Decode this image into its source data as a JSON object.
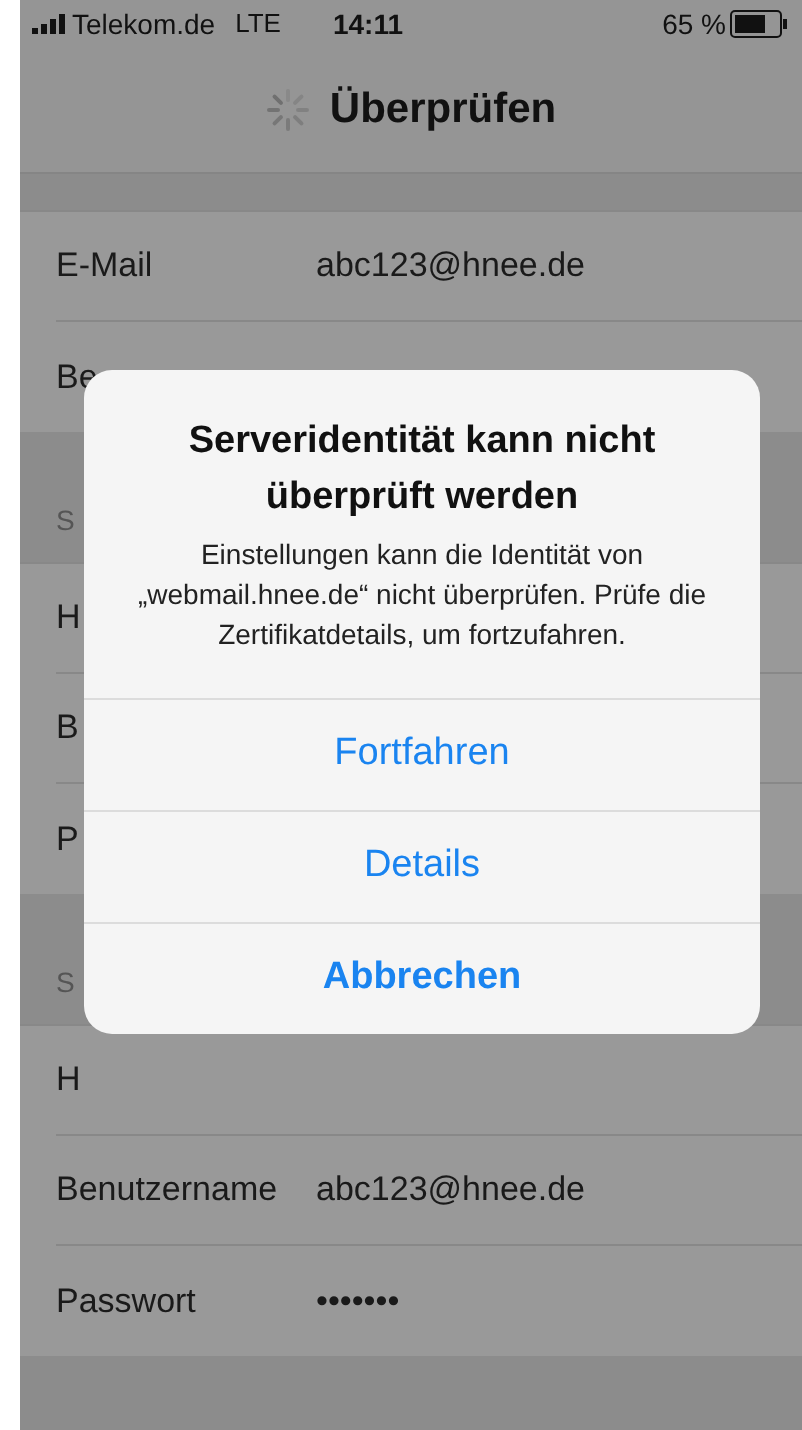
{
  "status_bar": {
    "carrier": "Telekom.de",
    "network": "LTE",
    "time": "14:11",
    "battery": "65 %"
  },
  "nav": {
    "title": "Überprüfen"
  },
  "sections": [
    {
      "rows": [
        {
          "label": "E-Mail",
          "value": "abc123@hnee.de"
        },
        {
          "label": "Be"
        }
      ]
    },
    {
      "header": "S",
      "rows": [
        {
          "label": "H"
        },
        {
          "label": "B"
        },
        {
          "label": "P"
        }
      ]
    },
    {
      "header": "S",
      "rows": [
        {
          "label": "H"
        },
        {
          "label": "Benutzername",
          "value": "abc123@hnee.de"
        },
        {
          "label": "Passwort",
          "value": "•••••••"
        }
      ]
    }
  ],
  "alert": {
    "title": "Serveridentität kann nicht überprüft werden",
    "message": "Einstellungen kann die Identität von „webmail.hnee.de“ nicht überprüfen. Prüfe die Zertifikatdetails, um fortzufahren.",
    "actions": [
      {
        "label": "Fortfahren",
        "kind": "default"
      },
      {
        "label": "Details",
        "kind": "default"
      },
      {
        "label": "Abbrechen",
        "kind": "cancel"
      }
    ]
  }
}
